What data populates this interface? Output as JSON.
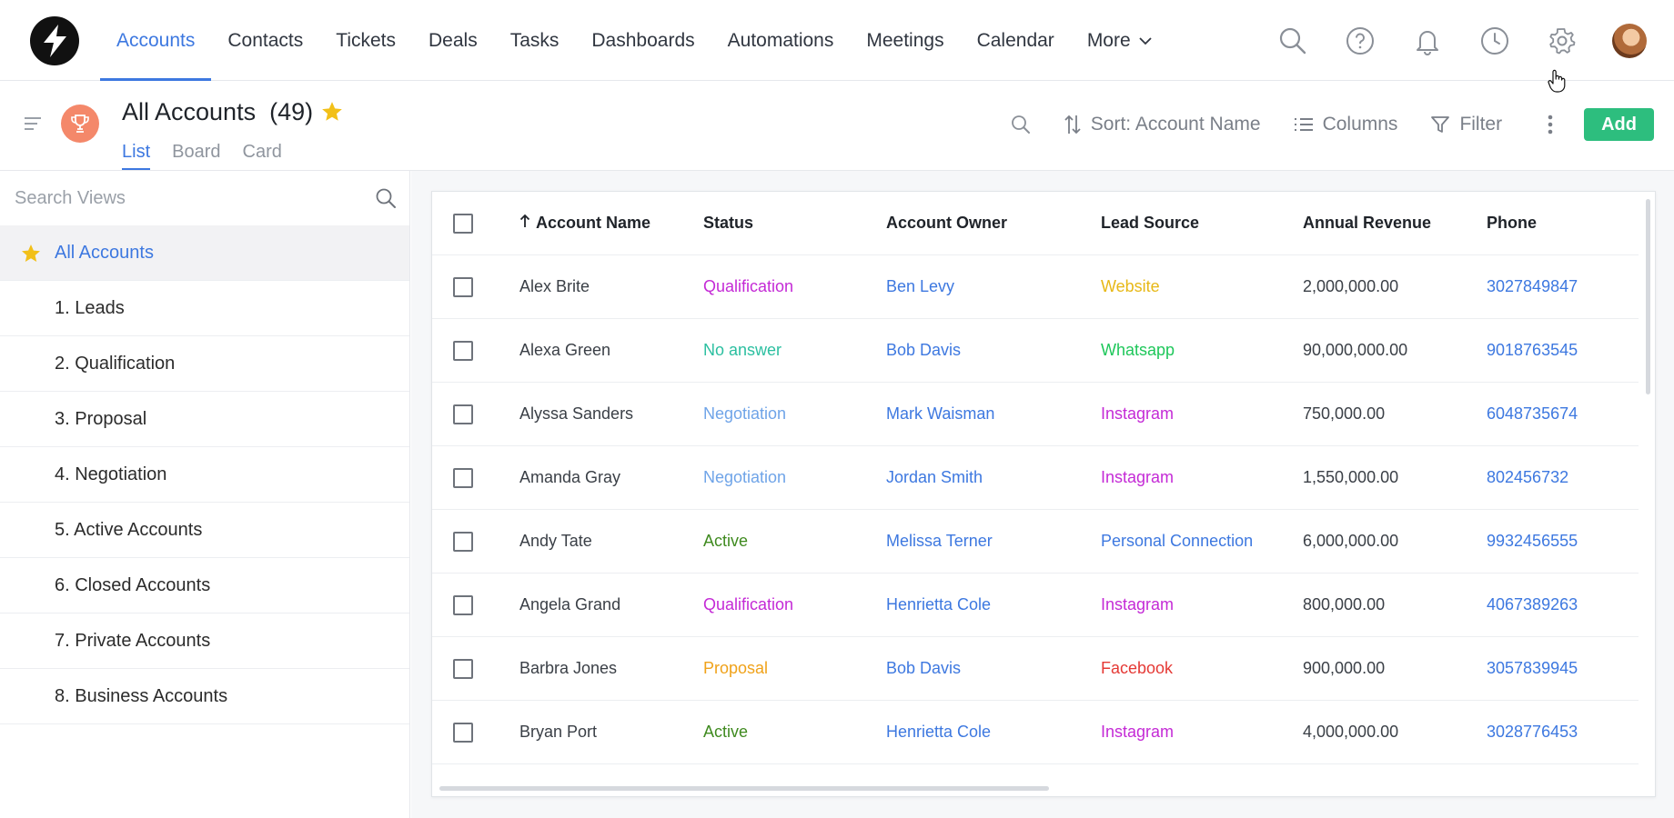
{
  "nav": {
    "items": [
      {
        "label": "Accounts",
        "active": true
      },
      {
        "label": "Contacts"
      },
      {
        "label": "Tickets"
      },
      {
        "label": "Deals"
      },
      {
        "label": "Tasks"
      },
      {
        "label": "Dashboards"
      },
      {
        "label": "Automations"
      },
      {
        "label": "Meetings"
      },
      {
        "label": "Calendar"
      }
    ],
    "more_label": "More",
    "icons": [
      "search-icon",
      "help-icon",
      "bell-icon",
      "clock-icon",
      "gear-icon",
      "avatar"
    ]
  },
  "header": {
    "title": "All Accounts",
    "count": "(49)",
    "tabs": [
      {
        "label": "List",
        "active": true
      },
      {
        "label": "Board"
      },
      {
        "label": "Card"
      }
    ],
    "sort_label": "Sort: Account Name",
    "columns_label": "Columns",
    "filter_label": "Filter",
    "add_label": "Add"
  },
  "sidebar": {
    "search_placeholder": "Search Views",
    "views": [
      {
        "label": "All Accounts",
        "active": true,
        "starred": true
      },
      {
        "label": "1. Leads"
      },
      {
        "label": "2. Qualification"
      },
      {
        "label": "3. Proposal"
      },
      {
        "label": "4. Negotiation"
      },
      {
        "label": "5. Active Accounts"
      },
      {
        "label": "6. Closed Accounts"
      },
      {
        "label": "7. Private Accounts"
      },
      {
        "label": "8. Business Accounts"
      }
    ]
  },
  "table": {
    "columns": [
      "Account Name",
      "Status",
      "Account Owner",
      "Lead Source",
      "Annual Revenue",
      "Phone"
    ],
    "rows": [
      {
        "name": "Alex Brite",
        "status": "Qualification",
        "status_color": "#c42ad6",
        "owner": "Ben Levy",
        "lead": "Website",
        "lead_color": "#e7b816",
        "revenue": "2,000,000.00",
        "phone": "3027849847"
      },
      {
        "name": "Alexa Green",
        "status": "No answer",
        "status_color": "#2bbfa0",
        "owner": "Bob Davis",
        "lead": "Whatsapp",
        "lead_color": "#1ec75a",
        "revenue": "90,000,000.00",
        "phone": "9018763545"
      },
      {
        "name": "Alyssa Sanders",
        "status": "Negotiation",
        "status_color": "#6fa4e8",
        "owner": "Mark Waisman",
        "lead": "Instagram",
        "lead_color": "#c42ad6",
        "revenue": "750,000.00",
        "phone": "6048735674"
      },
      {
        "name": "Amanda Gray",
        "status": "Negotiation",
        "status_color": "#6fa4e8",
        "owner": "Jordan Smith",
        "lead": "Instagram",
        "lead_color": "#c42ad6",
        "revenue": "1,550,000.00",
        "phone": "802456732"
      },
      {
        "name": "Andy Tate",
        "status": "Active",
        "status_color": "#3f8a1f",
        "owner": "Melissa Terner",
        "lead": "Personal Connection",
        "lead_color": "#3d78e0",
        "revenue": "6,000,000.00",
        "phone": "9932456555"
      },
      {
        "name": "Angela Grand",
        "status": "Qualification",
        "status_color": "#c42ad6",
        "owner": "Henrietta Cole",
        "lead": "Instagram",
        "lead_color": "#c42ad6",
        "revenue": "800,000.00",
        "phone": "4067389263"
      },
      {
        "name": "Barbra Jones",
        "status": "Proposal",
        "status_color": "#f0a21a",
        "owner": "Bob Davis",
        "lead": "Facebook",
        "lead_color": "#e53935",
        "revenue": "900,000.00",
        "phone": "3057839945"
      },
      {
        "name": "Bryan Port",
        "status": "Active",
        "status_color": "#3f8a1f",
        "owner": "Henrietta Cole",
        "lead": "Instagram",
        "lead_color": "#c42ad6",
        "revenue": "4,000,000.00",
        "phone": "3028776453"
      }
    ]
  },
  "colors": {
    "accent": "#3d78e0",
    "add_button": "#2dbe7e",
    "star": "#f2c019",
    "trophy_bg": "#f4886a"
  }
}
